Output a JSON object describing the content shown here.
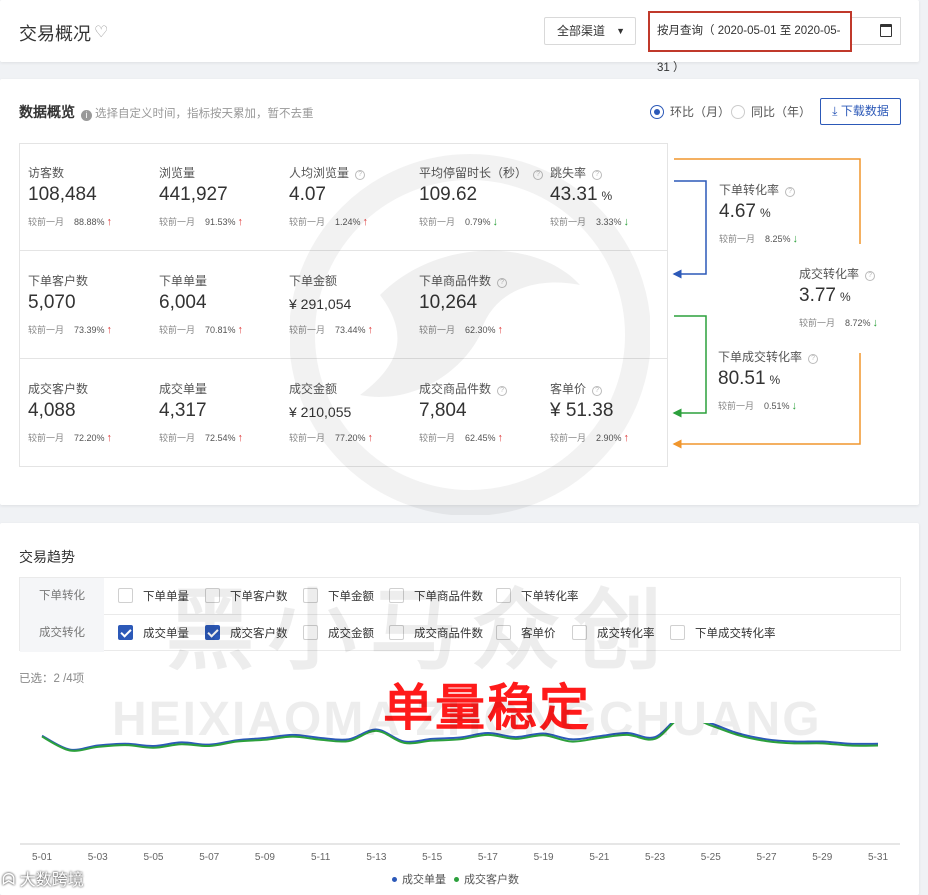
{
  "header": {
    "title": "交易概况",
    "channel": "全部渠道",
    "date_range": "按月查询（ 2020-05-01 至 2020-05-31 ）"
  },
  "overview": {
    "title": "数据概览",
    "hint": "选择自定义时间，指标按天累加，暂不去重",
    "radio_mom": "环比（月）",
    "radio_yoy": "同比（年）",
    "download": "下载数据",
    "compare_label": "较前一月",
    "metrics": [
      {
        "label": "访客数",
        "value": "108,484",
        "pct": "88.88%",
        "trend": "up"
      },
      {
        "label": "浏览量",
        "value": "441,927",
        "pct": "91.53%",
        "trend": "up"
      },
      {
        "label": "人均浏览量",
        "value": "4.07",
        "pct": "1.24%",
        "trend": "up"
      },
      {
        "label": "平均停留时长（秒）",
        "value": "109.62",
        "pct": "0.79%",
        "trend": "down"
      },
      {
        "label": "跳失率",
        "value": "43.31",
        "unit": "%",
        "pct": "3.33%",
        "trend": "down"
      },
      {
        "label": "下单客户数",
        "value": "5,070",
        "pct": "73.39%",
        "trend": "up"
      },
      {
        "label": "下单单量",
        "value": "6,004",
        "pct": "70.81%",
        "trend": "up"
      },
      {
        "label": "下单金额",
        "value": "¥ 291,054",
        "pct": "73.44%",
        "trend": "up"
      },
      {
        "label": "下单商品件数",
        "value": "10,264",
        "pct": "62.30%",
        "trend": "up"
      },
      {
        "label": "成交客户数",
        "value": "4,088",
        "pct": "72.20%",
        "trend": "up"
      },
      {
        "label": "成交单量",
        "value": "4,317",
        "pct": "72.54%",
        "trend": "up"
      },
      {
        "label": "成交金额",
        "value": "¥ 210,055",
        "pct": "77.20%",
        "trend": "up"
      },
      {
        "label": "成交商品件数",
        "value": "7,804",
        "pct": "62.45%",
        "trend": "up"
      },
      {
        "label": "客单价",
        "value": "¥ 51.38",
        "pct": "2.90%",
        "trend": "up"
      }
    ],
    "conversions": [
      {
        "label": "下单转化率",
        "value": "4.67",
        "unit": "%",
        "pct": "8.25%",
        "trend": "down"
      },
      {
        "label": "成交转化率",
        "value": "3.77",
        "unit": "%",
        "pct": "8.72%",
        "trend": "down"
      },
      {
        "label": "下单成交转化率",
        "value": "80.51",
        "unit": "%",
        "pct": "0.51%",
        "trend": "down"
      }
    ]
  },
  "trend": {
    "title": "交易趋势",
    "order_row": {
      "label": "下单转化",
      "options": [
        {
          "label": "下单单量",
          "checked": false
        },
        {
          "label": "下单客户数",
          "checked": false
        },
        {
          "label": "下单金额",
          "checked": false
        },
        {
          "label": "下单商品件数",
          "checked": false
        },
        {
          "label": "下单转化率",
          "checked": false
        }
      ]
    },
    "deal_row": {
      "label": "成交转化",
      "options": [
        {
          "label": "成交单量",
          "checked": true
        },
        {
          "label": "成交客户数",
          "checked": true
        },
        {
          "label": "成交金额",
          "checked": false
        },
        {
          "label": "成交商品件数",
          "checked": false
        },
        {
          "label": "客单价",
          "checked": false
        },
        {
          "label": "成交转化率",
          "checked": false
        },
        {
          "label": "下单成交转化率",
          "checked": false
        }
      ]
    },
    "selected_count": "已选：2 /4项",
    "overlay_caption": "单量稳定"
  },
  "chart_data": {
    "type": "line",
    "x": [
      "5-01",
      "5-02",
      "5-03",
      "5-04",
      "5-05",
      "5-06",
      "5-07",
      "5-08",
      "5-09",
      "5-10",
      "5-11",
      "5-12",
      "5-13",
      "5-14",
      "5-15",
      "5-16",
      "5-17",
      "5-18",
      "5-19",
      "5-20",
      "5-21",
      "5-22",
      "5-23",
      "5-24",
      "5-25",
      "5-26",
      "5-27",
      "5-28",
      "5-29",
      "5-30",
      "5-31"
    ],
    "tick_labels": [
      "5-01",
      "5-03",
      "5-05",
      "5-07",
      "5-09",
      "5-11",
      "5-13",
      "5-15",
      "5-17",
      "5-19",
      "5-21",
      "5-23",
      "5-25",
      "5-27",
      "5-29",
      "5-31"
    ],
    "series": [
      {
        "name": "成交单量",
        "color": "#2c59b8",
        "values": [
          153,
          122,
          131,
          135,
          130,
          138,
          133,
          143,
          148,
          155,
          148,
          145,
          167,
          140,
          146,
          149,
          159,
          150,
          158,
          145,
          152,
          159,
          150,
          200,
          181,
          158,
          145,
          140,
          140,
          135,
          135
        ]
      },
      {
        "name": "成交客户数",
        "color": "#2ca03c",
        "values": [
          151,
          120,
          128,
          132,
          126,
          134,
          130,
          140,
          144,
          151,
          144,
          141,
          164,
          137,
          142,
          145,
          155,
          146,
          154,
          140,
          148,
          155,
          146,
          196,
          176,
          154,
          141,
          136,
          136,
          131,
          131
        ]
      }
    ],
    "ylim": [
      0,
      260
    ]
  },
  "watermark": {
    "cn": "黑小马众创",
    "en": "HEIXIAOMA ZHONGCHUANG",
    "brand": "大数跨境"
  },
  "colors": {
    "accent": "#2c59b8",
    "up": "#e03c3c",
    "down": "#2ca03c",
    "highlight_border": "#c0392b",
    "flow_orange": "#f0962d"
  }
}
